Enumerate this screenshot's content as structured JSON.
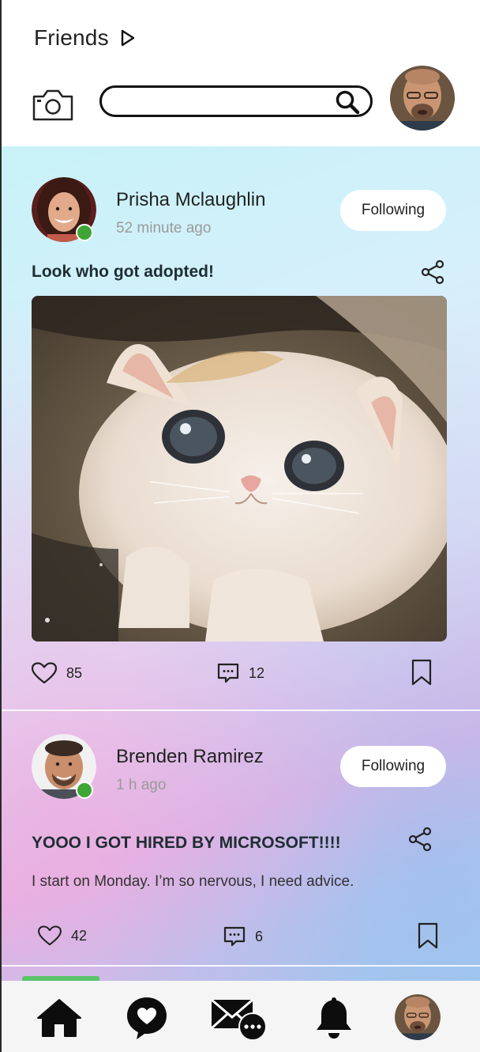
{
  "header": {
    "title": "Friends",
    "search": {
      "value": "",
      "placeholder": ""
    }
  },
  "posts": [
    {
      "author": "Prisha Mclaughlin",
      "time": "52 minute ago",
      "follow_label": "Following",
      "heading": "Look who got adopted!",
      "body": "",
      "likes": "85",
      "comments": "12",
      "image_icon": "kitten-photo"
    },
    {
      "author": "Brenden Ramirez",
      "time": "1 h ago",
      "follow_label": "Following",
      "heading": "YOOO I GOT HIRED BY MICROSOFT!!!!",
      "body": "I start on Monday. I’m so nervous, I need advice.",
      "likes": "42",
      "comments": "6"
    }
  ],
  "nav": {
    "items": [
      "home-icon",
      "heart-chat-icon",
      "messages-icon",
      "bell-icon",
      "profile-avatar"
    ]
  },
  "colors": {
    "online": "#3fa535",
    "accent_strip": "#5cc46a"
  }
}
